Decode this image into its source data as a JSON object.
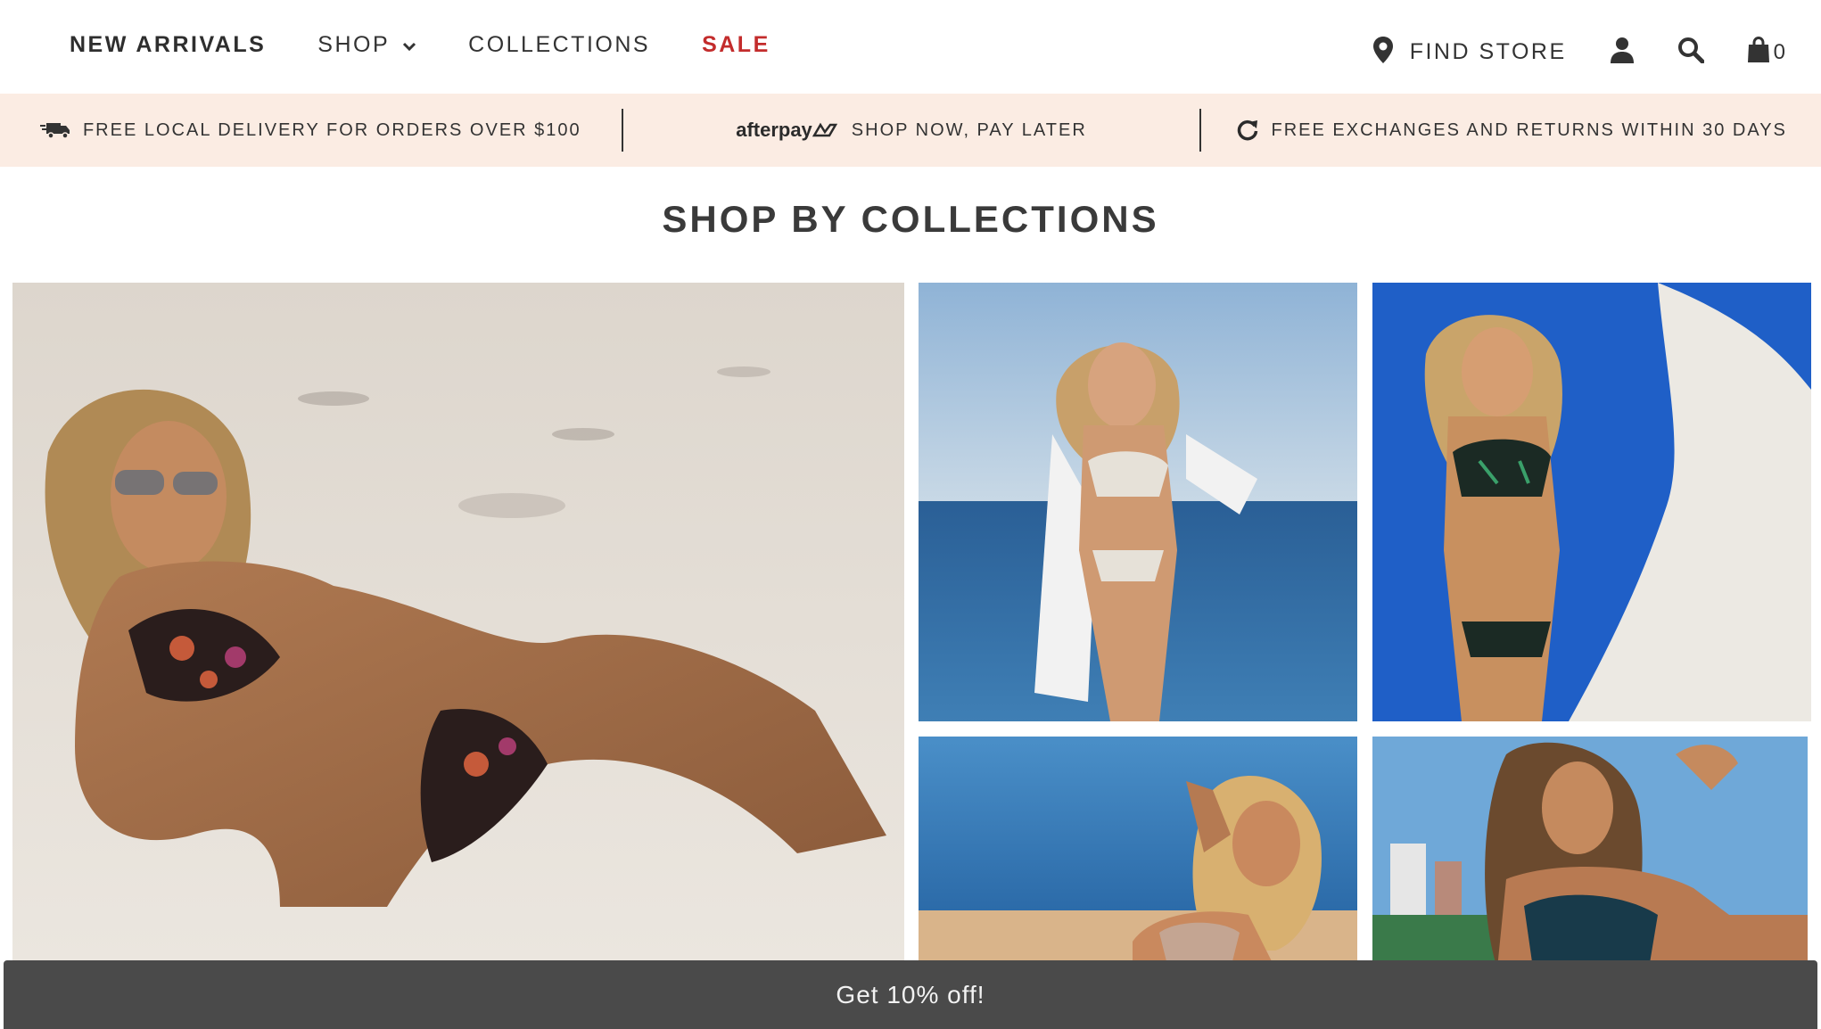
{
  "nav": {
    "items": [
      {
        "label": "NEW ARRIVALS"
      },
      {
        "label": "SHOP"
      },
      {
        "label": "COLLECTIONS"
      },
      {
        "label": "SALE"
      }
    ]
  },
  "utilities": {
    "find_store": "FIND STORE",
    "cart_count": "0",
    "icons": [
      "location-pin-icon",
      "account-icon",
      "search-icon",
      "cart-bag-icon"
    ]
  },
  "promo_bar": {
    "delivery": "FREE LOCAL DELIVERY FOR ORDERS OVER $100",
    "afterpay_logo": "afterpay",
    "afterpay_text": "SHOP NOW, PAY LATER",
    "returns": "FREE EXCHANGES AND RETURNS WITHIN 30 DAYS",
    "background": "#fbece3"
  },
  "section": {
    "title": "SHOP BY COLLECTIONS"
  },
  "popup": {
    "label": "Get 10% off!"
  },
  "colors": {
    "sale": "#c32c2c",
    "text": "#333333",
    "popup_bg": "#4a4a4a"
  }
}
